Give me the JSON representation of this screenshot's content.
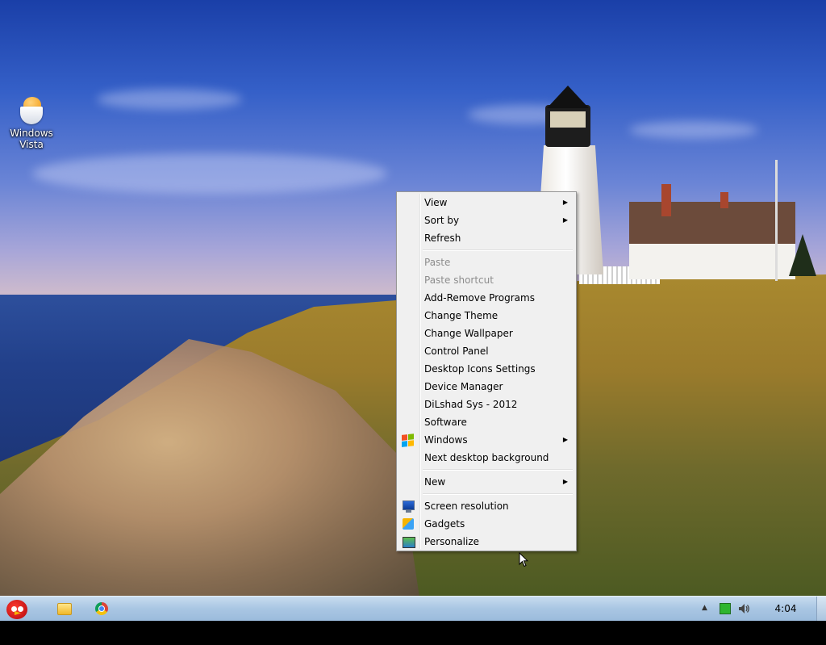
{
  "desktop": {
    "icons": [
      {
        "label": "Windows Vista"
      }
    ]
  },
  "context_menu": {
    "groups": [
      [
        {
          "label": "View",
          "submenu": true,
          "disabled": false
        },
        {
          "label": "Sort by",
          "submenu": true,
          "disabled": false
        },
        {
          "label": "Refresh",
          "submenu": false,
          "disabled": false
        }
      ],
      [
        {
          "label": "Paste",
          "submenu": false,
          "disabled": true
        },
        {
          "label": "Paste shortcut",
          "submenu": false,
          "disabled": true
        },
        {
          "label": "Add-Remove Programs",
          "submenu": false,
          "disabled": false
        },
        {
          "label": "Change Theme",
          "submenu": false,
          "disabled": false
        },
        {
          "label": "Change Wallpaper",
          "submenu": false,
          "disabled": false
        },
        {
          "label": "Control Panel",
          "submenu": false,
          "disabled": false
        },
        {
          "label": "Desktop Icons Settings",
          "submenu": false,
          "disabled": false
        },
        {
          "label": "Device Manager",
          "submenu": false,
          "disabled": false
        },
        {
          "label": "DiLshad Sys - 2012",
          "submenu": false,
          "disabled": false
        },
        {
          "label": "Software",
          "submenu": false,
          "disabled": false
        },
        {
          "label": "Windows",
          "submenu": true,
          "disabled": false,
          "icon": "windows-flag-icon"
        },
        {
          "label": "Next desktop background",
          "submenu": false,
          "disabled": false
        }
      ],
      [
        {
          "label": "New",
          "submenu": true,
          "disabled": false
        }
      ],
      [
        {
          "label": "Screen resolution",
          "submenu": false,
          "disabled": false,
          "icon": "screen-resolution-icon"
        },
        {
          "label": "Gadgets",
          "submenu": false,
          "disabled": false,
          "icon": "gadgets-icon"
        },
        {
          "label": "Personalize",
          "submenu": false,
          "disabled": false,
          "icon": "personalize-icon"
        }
      ]
    ],
    "submenu_arrow": "▶"
  },
  "taskbar": {
    "start_icon": "angry-bird-icon",
    "pinned": [
      "explorer-folder-icon",
      "chrome-icon"
    ],
    "tray": {
      "icons": [
        "show-hidden-icons-arrow",
        "network-icon",
        "volume-icon"
      ],
      "arrow_glyph": "▲",
      "clock": "4:04 AM"
    }
  },
  "colors": {
    "menu_bg": "#f0f0f0",
    "menu_border": "#979797",
    "taskbar_top": "#c8dcef",
    "taskbar_bottom": "#9bbbdc"
  }
}
